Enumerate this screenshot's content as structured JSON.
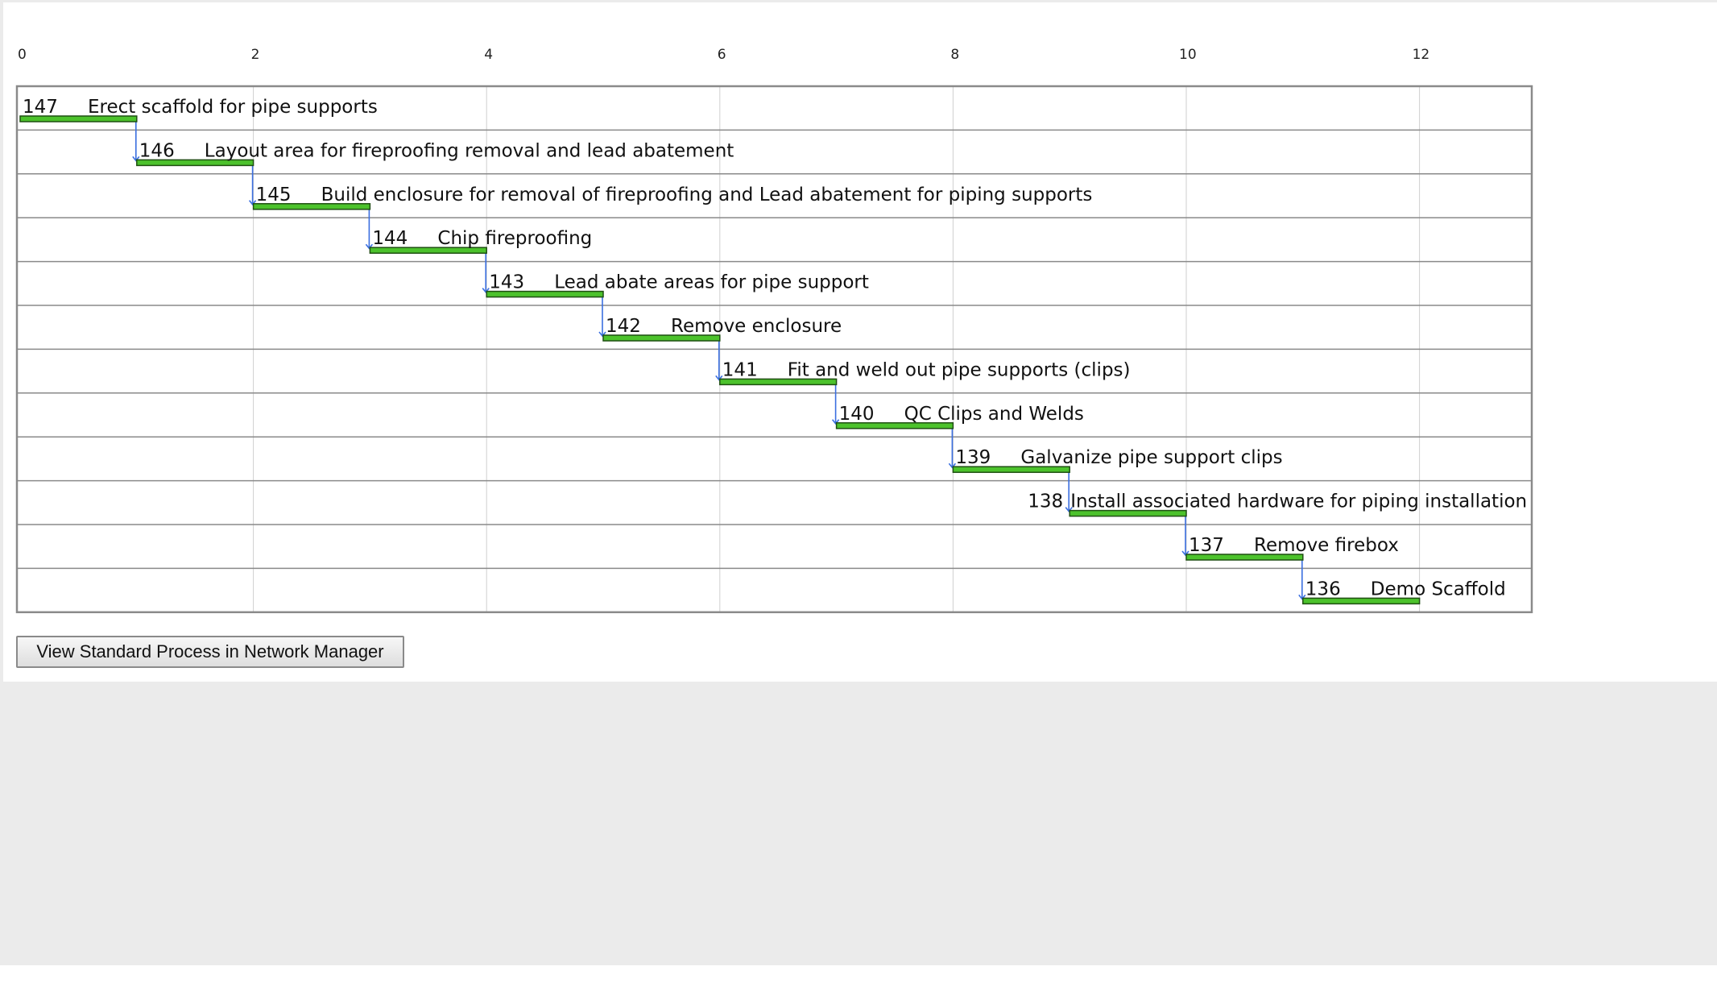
{
  "chart_data": {
    "type": "gantt",
    "xlim": [
      0,
      13
    ],
    "ticks": [
      0,
      2,
      4,
      6,
      8,
      10,
      12
    ],
    "grid": true,
    "tasks": [
      {
        "id": "147",
        "name": "Erect scaffold for pipe supports",
        "start": 0,
        "end": 1
      },
      {
        "id": "146",
        "name": "Layout area for fireproofing removal and lead abatement",
        "start": 1,
        "end": 2
      },
      {
        "id": "145",
        "name": "Build enclosure for removal of fireproofing and Lead abatement for piping supports",
        "start": 2,
        "end": 3
      },
      {
        "id": "144",
        "name": "Chip fireproofing",
        "start": 3,
        "end": 4
      },
      {
        "id": "143",
        "name": "Lead abate areas for pipe support",
        "start": 4,
        "end": 5
      },
      {
        "id": "142",
        "name": "Remove enclosure",
        "start": 5,
        "end": 6
      },
      {
        "id": "141",
        "name": "Fit and weld out pipe supports (clips)",
        "start": 6,
        "end": 7
      },
      {
        "id": "140",
        "name": "QC Clips and Welds",
        "start": 7,
        "end": 8
      },
      {
        "id": "139",
        "name": "Galvanize pipe support clips",
        "start": 8,
        "end": 9
      },
      {
        "id": "138",
        "name": "Install associated hardware for piping installation",
        "start": 9,
        "end": 10,
        "label_left": true
      },
      {
        "id": "137",
        "name": "Remove firebox",
        "start": 10,
        "end": 11
      },
      {
        "id": "136",
        "name": "Demo Scaffold",
        "start": 11,
        "end": 12
      }
    ],
    "colors": {
      "bar": "#4cc22c",
      "bar_border": "#1f4f12",
      "link": "#3b6fe0",
      "grid": "#cfcfcf",
      "row_line": "#8a8a8a"
    }
  },
  "button": {
    "label": "View Standard Process in Network Manager"
  }
}
